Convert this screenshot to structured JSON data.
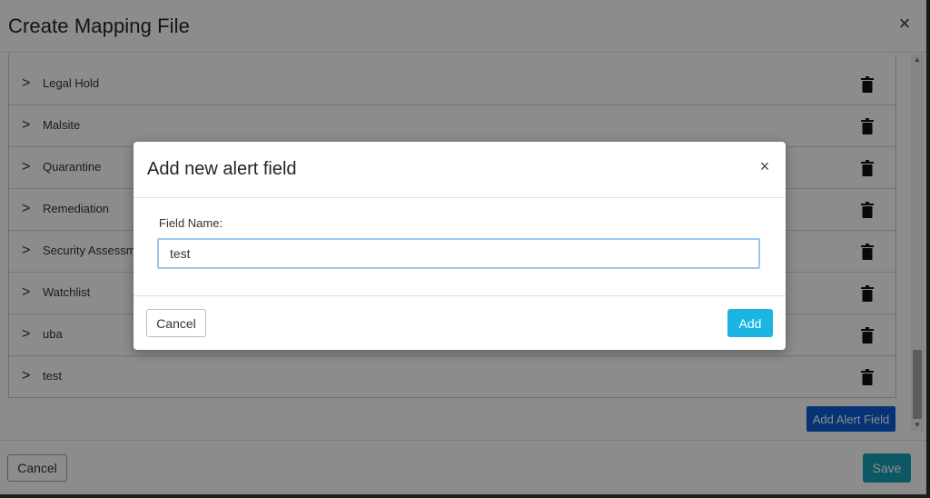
{
  "outer_modal": {
    "title": "Create Mapping File",
    "close_glyph": "×",
    "add_field_label": "Add Alert Field",
    "cancel_label": "Cancel",
    "save_label": "Save"
  },
  "fields": [
    {
      "label": "Legal Hold"
    },
    {
      "label": "Malsite"
    },
    {
      "label": "Quarantine"
    },
    {
      "label": "Remediation"
    },
    {
      "label": "Security Assessment"
    },
    {
      "label": "Watchlist"
    },
    {
      "label": "uba"
    },
    {
      "label": "test"
    }
  ],
  "row_chevron": ">",
  "icons": {
    "expand": "chevron-right-icon",
    "delete": "trash-icon",
    "close": "close-icon"
  },
  "dialog": {
    "title": "Add new alert field",
    "close_glyph": "×",
    "field_label": "Field Name:",
    "field_value": "test",
    "cancel_label": "Cancel",
    "add_label": "Add"
  },
  "colors": {
    "primary": "#0b5ed7",
    "info": "#17a2b8",
    "add_button": "#1ab5e2",
    "input_focus_border": "#9cc6ee"
  }
}
